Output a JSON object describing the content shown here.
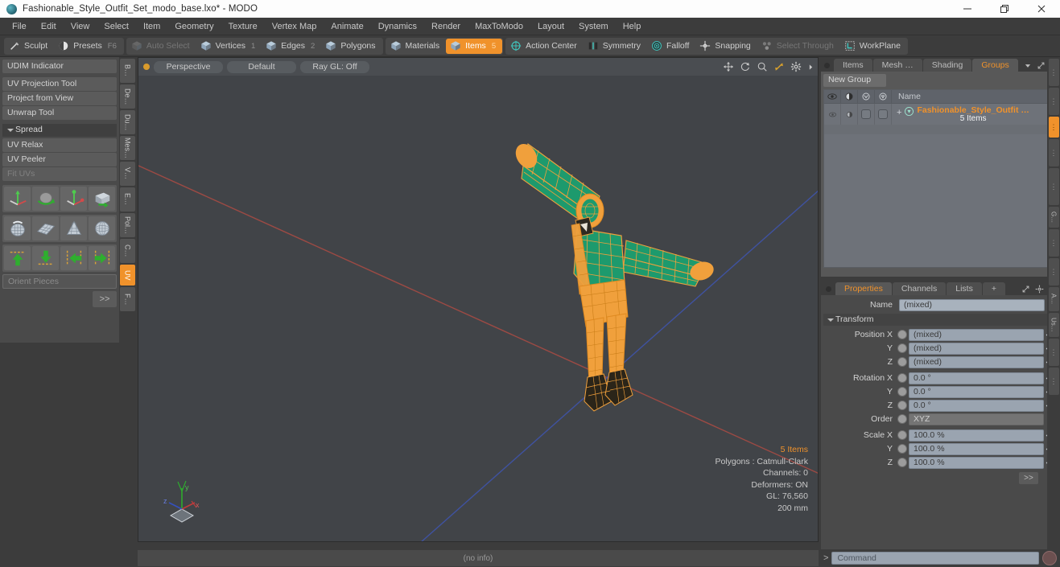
{
  "window": {
    "title": "Fashionable_Style_Outfit_Set_modo_base.lxo* - MODO",
    "minimize_label": "—",
    "restore_label": "❐",
    "close_label": "✕"
  },
  "menu": {
    "items": [
      {
        "label": "File"
      },
      {
        "label": "Edit"
      },
      {
        "label": "View"
      },
      {
        "label": "Select"
      },
      {
        "label": "Item"
      },
      {
        "label": "Geometry"
      },
      {
        "label": "Texture"
      },
      {
        "label": "Vertex Map"
      },
      {
        "label": "Animate"
      },
      {
        "label": "Dynamics"
      },
      {
        "label": "Render"
      },
      {
        "label": "MaxToModo"
      },
      {
        "label": "Layout"
      },
      {
        "label": "System"
      },
      {
        "label": "Help"
      }
    ]
  },
  "modebar": {
    "group1": [
      {
        "label": "Sculpt",
        "icon": "brush-icon",
        "count": "",
        "state": "normal"
      },
      {
        "label": "Presets",
        "icon": "sphere-icon",
        "count": "F6",
        "state": "normal"
      }
    ],
    "group2": [
      {
        "label": "Auto Select",
        "icon": "cube-icon",
        "count": "",
        "state": "disabled"
      },
      {
        "label": "Vertices",
        "icon": "cube-icon",
        "count": "1",
        "state": "normal"
      },
      {
        "label": "Edges",
        "icon": "cube-icon",
        "count": "2",
        "state": "normal"
      },
      {
        "label": "Polygons",
        "icon": "cube-icon",
        "count": "",
        "state": "normal"
      }
    ],
    "group3": [
      {
        "label": "Materials",
        "icon": "cube-icon",
        "count": "",
        "state": "normal"
      },
      {
        "label": "Items",
        "icon": "cube-icon",
        "count": "5",
        "state": "active"
      }
    ],
    "group4": [
      {
        "label": "Action Center",
        "icon": "target-icon",
        "count": "",
        "state": "normal"
      },
      {
        "label": "Symmetry",
        "icon": "symmetry-icon",
        "count": "",
        "state": "normal"
      },
      {
        "label": "Falloff",
        "icon": "falloff-icon",
        "count": "",
        "state": "normal"
      },
      {
        "label": "Snapping",
        "icon": "snap-icon",
        "count": "",
        "state": "normal"
      },
      {
        "label": "Select Through",
        "icon": "select-through-icon",
        "count": "",
        "state": "disabled"
      },
      {
        "label": "WorkPlane",
        "icon": "workplane-icon",
        "count": "",
        "state": "normal"
      }
    ]
  },
  "leftpanel": {
    "buttons_top": [
      {
        "label": "UDIM Indicator",
        "dim": false
      }
    ],
    "buttons_mid": [
      {
        "label": "UV Projection Tool",
        "dim": false
      },
      {
        "label": "Project from View",
        "dim": false
      },
      {
        "label": "Unwrap Tool",
        "dim": false
      }
    ],
    "section_label": "Spread",
    "buttons_bottom": [
      {
        "label": "UV Relax",
        "dim": false
      },
      {
        "label": "UV Peeler",
        "dim": false
      },
      {
        "label": "Fit UVs",
        "dim": true
      }
    ],
    "icon_rows": [
      [
        "move-gizmo-icon",
        "rotate-gizmo-icon",
        "scale-gizmo-icon",
        "flip-box-icon"
      ],
      [
        "shrink-wrap-icon",
        "grid-plane-icon",
        "cone-unwrap-icon",
        "sphere-unwrap-icon"
      ],
      [
        "align-up-icon",
        "align-down-icon",
        "align-left-icon",
        "align-right-icon"
      ]
    ],
    "field_placeholder": "Orient Pieces",
    "more_label": ">>",
    "vtabs": [
      {
        "label": "B…",
        "active": false
      },
      {
        "label": "De…",
        "active": false
      },
      {
        "label": "Du…",
        "active": false
      },
      {
        "label": "Mes…",
        "active": false
      },
      {
        "label": "V…",
        "active": false
      },
      {
        "label": "E…",
        "active": false
      },
      {
        "label": "Pol…",
        "active": false
      },
      {
        "label": "C…",
        "active": false
      },
      {
        "label": "UV",
        "active": true
      },
      {
        "label": "F…",
        "active": false
      }
    ]
  },
  "viewport": {
    "pills": [
      {
        "label": "Perspective"
      },
      {
        "label": "Default"
      },
      {
        "label": "Ray GL: Off"
      }
    ],
    "tool_icons": [
      "pan-icon",
      "rotate-icon",
      "zoom-icon",
      "fit-icon",
      "gear-icon",
      "chevron-right-icon"
    ],
    "stats": {
      "items": "5 Items",
      "polygons": "Polygons : Catmull-Clark",
      "channels": "Channels: 0",
      "deformers": "Deformers: ON",
      "gl": "GL: 76,560",
      "scale": "200 mm"
    },
    "axis_labels": {
      "x": "x",
      "y": "y",
      "z": "z"
    },
    "colors": {
      "background": "#414448",
      "x_axis": "#b5524a",
      "z_axis": "#4a5fb5",
      "wire": "#f0a03c",
      "surface": "#1e9b6e"
    }
  },
  "rightpanel": {
    "tabs": [
      {
        "label": "Items",
        "active": false
      },
      {
        "label": "Mesh …",
        "active": false
      },
      {
        "label": "Shading",
        "active": false
      },
      {
        "label": "Groups",
        "active": true
      }
    ],
    "tab_menu_icon": "chevron-down-icon",
    "expand_icon": "expand-icon",
    "more_icon": "chevron-right-icon",
    "new_group_label": "New Group",
    "tree_columns": [
      "eye-icon",
      "render-icon",
      "shade-icon",
      "lock-icon"
    ],
    "tree_name_header": "Name",
    "tree_rows": [
      {
        "expander": "+",
        "icon": "group-icon",
        "name": "Fashionable_Style_Outfit …",
        "sub": "5 Items"
      }
    ]
  },
  "properties": {
    "tabs": [
      {
        "label": "Properties",
        "active": true
      },
      {
        "label": "Channels",
        "active": false
      },
      {
        "label": "Lists",
        "active": false
      },
      {
        "label": "+",
        "active": false
      }
    ],
    "header_icons": [
      "expand-icon",
      "gear-icon",
      "chevron-right-icon"
    ],
    "name_label": "Name",
    "name_value": "(mixed)",
    "transform_label": "Transform",
    "rows": [
      {
        "label": "Position X",
        "value": "(mixed)",
        "type": "field"
      },
      {
        "label": "Y",
        "value": "(mixed)",
        "type": "field"
      },
      {
        "label": "Z",
        "value": "(mixed)",
        "type": "field"
      },
      {
        "label": "Rotation X",
        "value": "0.0 °",
        "type": "field"
      },
      {
        "label": "Y",
        "value": "0.0 °",
        "type": "field"
      },
      {
        "label": "Z",
        "value": "0.0 °",
        "type": "field"
      },
      {
        "label": "Order",
        "value": "XYZ",
        "type": "dropdown"
      },
      {
        "label": "Scale X",
        "value": "100.0 %",
        "type": "field"
      },
      {
        "label": "Y",
        "value": "100.0 %",
        "type": "field"
      },
      {
        "label": "Z",
        "value": "100.0 %",
        "type": "field"
      }
    ],
    "more_label": ">>"
  },
  "farstrip": {
    "tabs": [
      {
        "label": "",
        "active": false
      },
      {
        "label": "",
        "active": false
      },
      {
        "label": "",
        "active": true
      },
      {
        "label": "",
        "active": false
      },
      {
        "label": "",
        "active": false
      },
      {
        "label": "G…",
        "active": false
      },
      {
        "label": "",
        "active": false
      },
      {
        "label": "",
        "active": false
      },
      {
        "label": "A…",
        "active": false
      },
      {
        "label": "Us…",
        "active": false
      },
      {
        "label": "",
        "active": false
      },
      {
        "label": "",
        "active": false
      }
    ]
  },
  "bottombar": {
    "info": "(no info)",
    "command_arrow": ">",
    "command_placeholder": "Command",
    "command_value": "",
    "exec_icon": "record-icon"
  }
}
